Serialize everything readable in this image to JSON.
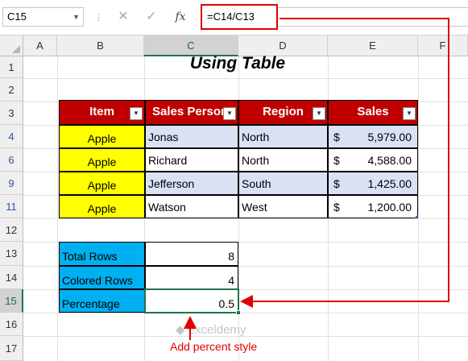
{
  "formula_bar": {
    "name_box": "C15",
    "cancel_icon": "✕",
    "enter_icon": "✓",
    "fx_label": "fx",
    "formula": "=C14/C13"
  },
  "columns": [
    "A",
    "B",
    "C",
    "D",
    "E",
    "F"
  ],
  "selected_column": "C",
  "rows": [
    "1",
    "2",
    "3",
    "4",
    "6",
    "9",
    "11",
    "12",
    "13",
    "14",
    "15",
    "16",
    "17"
  ],
  "selected_row": "15",
  "title": "Using Table",
  "table": {
    "headers": [
      "Item",
      "Sales Person",
      "Region",
      "Sales"
    ],
    "currency_symbol": "$",
    "rows": [
      {
        "item": "Apple",
        "person": "Jonas",
        "region": "North",
        "sales": "5,979.00"
      },
      {
        "item": "Apple",
        "person": "Richard",
        "region": "North",
        "sales": "4,588.00"
      },
      {
        "item": "Apple",
        "person": "Jefferson",
        "region": "South",
        "sales": "1,425.00"
      },
      {
        "item": "Apple",
        "person": "Watson",
        "region": "West",
        "sales": "1,200.00"
      }
    ]
  },
  "summary": [
    {
      "label": "Total Rows",
      "value": "8"
    },
    {
      "label": "Colored Rows",
      "value": "4"
    },
    {
      "label": "Percentage",
      "value": "0.5"
    }
  ],
  "annotation": "Add percent style",
  "watermark": "exceldemy",
  "colors": {
    "header_red": "#c00000",
    "item_yellow": "#ffff00",
    "band_blue": "#d9e1f2",
    "summary_cyan": "#00b0f0",
    "excel_green": "#217346",
    "annotation_red": "#e00000"
  }
}
